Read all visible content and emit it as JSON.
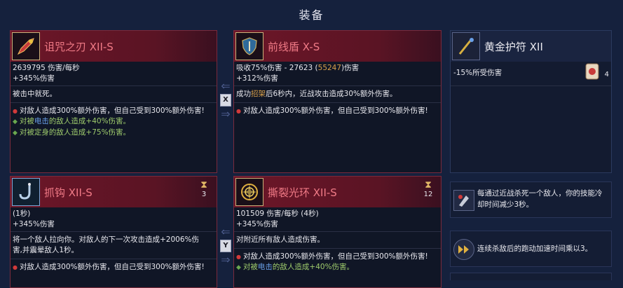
{
  "screen_title": "装备",
  "swap_keys": {
    "top": "X",
    "bottom": "Y"
  },
  "colors": {
    "weapon_border": "#7a2a3c",
    "accent_gold": "#d8a04a",
    "mod_green": "#9ecb6c",
    "mod_blue": "#6aa0e8"
  },
  "cards": {
    "curse_blade": {
      "name": "诅咒之刃  XII-S",
      "icon": "curse-blade-icon",
      "stats": [
        "2639795 伤害/每秒",
        "+345%伤害"
      ],
      "desc": "被击中就死。",
      "mods": {
        "red": "对敌人造成300%额外伤害，但自己受到300%额外伤害!",
        "green1_pre": "对被",
        "green1_hl": "电击",
        "green1_post": "的敌人造成+40%伤害。",
        "green2": "对被定身的敌人造成+75%伤害。"
      }
    },
    "front_shield": {
      "name": "前线盾  X-S",
      "icon": "shield-icon",
      "stats_pre": "吸收75%伤害 - 27623 (",
      "stats_gold": "55247",
      "stats_post": ")伤害",
      "stats2": "+312%伤害",
      "desc_pre": "成功",
      "desc_gold": "招架",
      "desc_post": "后6秒内，近战攻击造成30%额外伤害。",
      "mods": {
        "red": "对敌人造成300%额外伤害，但自己受到300%额外伤害!"
      }
    },
    "golden_amulet": {
      "name": "黄金护符  XII",
      "icon": "amulet-icon",
      "stat": "-15%所受伤害",
      "scroll_count": "4"
    },
    "grappling_hook": {
      "name": "抓钩  XII-S",
      "icon": "grappling-hook-icon",
      "charges": "3",
      "stats": [
        "(1秒)",
        "+345%伤害"
      ],
      "desc_line1": "将一个敌人拉向你。对敌人的下一次攻击造成+2006%伤",
      "desc_line2": "害,并震晕敌人1秒。",
      "mods": {
        "red": "对敌人造成300%额外伤害，但自己受到300%额外伤害!"
      }
    },
    "tearing_aura": {
      "name": "撕裂光环  XII-S",
      "icon": "tearing-aura-icon",
      "charges": "12",
      "stats": [
        "101509 伤害/每秒 (4秒)",
        "+345%伤害"
      ],
      "desc": "对附近所有敌人造成伤害。",
      "mods": {
        "red": "对敌人造成300%额外伤害，但自己受到300%额外伤害!",
        "green1_pre": "对被",
        "green1_hl": "电击",
        "green1_post": "的敌人造成+40%伤害。"
      }
    }
  },
  "mutations": [
    {
      "icon": "kill-cooldown-icon",
      "line1": "每通过近战杀死一个敌人，你的技能冷",
      "line2": "却时间减少3秒。"
    },
    {
      "icon": "speed-boost-icon",
      "line1": "连续杀敌后的跑动加速时间乘以3。"
    }
  ]
}
